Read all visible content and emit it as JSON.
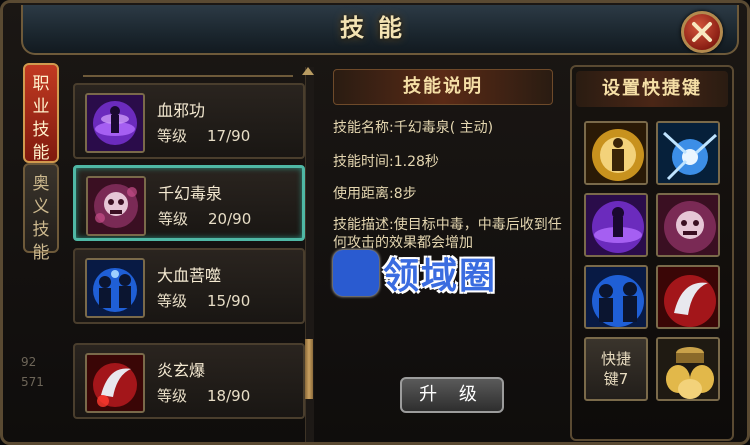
{
  "window": {
    "title": "技能"
  },
  "tabs": [
    {
      "label": "职业技能",
      "active": true
    },
    {
      "label": "奥义技能",
      "active": false
    }
  ],
  "side_numbers": [
    "92",
    "571"
  ],
  "skills": [
    {
      "name": "血邪功",
      "level_label": "等级",
      "level": "17/90",
      "icon": "purple-vortex-icon"
    },
    {
      "name": "千幻毒泉",
      "level_label": "等级",
      "level": "20/90",
      "icon": "poison-skull-icon",
      "selected": true
    },
    {
      "name": "大血菩噬",
      "level_label": "等级",
      "level": "15/90",
      "icon": "blue-spirit-icon"
    },
    {
      "name": "炎玄爆",
      "level_label": "等级",
      "level": "18/90",
      "icon": "red-claw-icon"
    }
  ],
  "description": {
    "header": "技能说明",
    "name_line": "技能名称:千幻毒泉( 主动)",
    "time_line": "技能时间:1.28秒",
    "range_line": "使用距离:8步",
    "desc_line": "技能描述:使目标中毒，中毒后收到任何攻击的效果都会增加"
  },
  "upgrade_button": "升 级",
  "quickkeys": {
    "header": "设置快捷键",
    "slot7_label": "快捷键7",
    "slots": [
      "golden-figure-icon",
      "lightning-icon",
      "purple-vortex-icon",
      "poison-skull-icon",
      "blue-spirit-icon",
      "red-claw-icon",
      "quickkey-7-text",
      "gold-pots-icon"
    ]
  },
  "watermark": {
    "text": "领域圈"
  },
  "colors": {
    "accent": "#4fb8a5",
    "tab_active": "#c23a22",
    "gold": "#f5dfa6"
  }
}
